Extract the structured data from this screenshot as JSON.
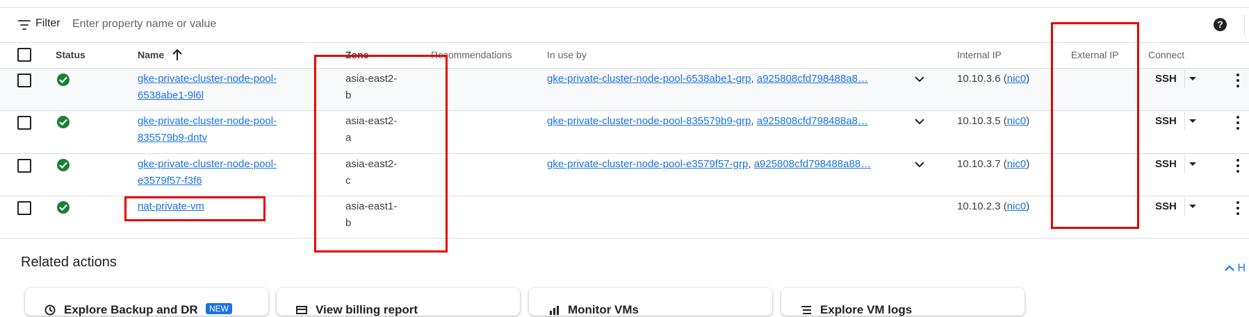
{
  "filter": {
    "label": "Filter",
    "placeholder": "Enter property name or value",
    "help_icon": "?"
  },
  "columns": {
    "status": "Status",
    "name": "Name",
    "zone": "Zone",
    "recommendations": "Recommendations",
    "in_use_by": "In use by",
    "internal_ip": "Internal IP",
    "external_ip": "External IP",
    "connect": "Connect"
  },
  "rows": [
    {
      "name_line1": "gke-private-cluster-node-pool-",
      "name_line2": "6538abe1-9l6l",
      "zone_line1": "asia-east2-",
      "zone_line2": "b",
      "in_use_link1": "gke-private-cluster-node-pool-6538abe1-grp",
      "in_use_sep": ", ",
      "in_use_link2": "a925808cfd798488a8…",
      "ip": "10.10.3.6",
      "ip_open": " (",
      "nic": "nic0",
      "ip_close": ")",
      "connect": "SSH",
      "status": "running"
    },
    {
      "name_line1": "gke-private-cluster-node-pool-",
      "name_line2": "835579b9-dntv",
      "zone_line1": "asia-east2-",
      "zone_line2": "a",
      "in_use_link1": "gke-private-cluster-node-pool-835579b9-grp",
      "in_use_sep": ", ",
      "in_use_link2": "a925808cfd798488a8…",
      "ip": "10.10.3.5",
      "ip_open": " (",
      "nic": "nic0",
      "ip_close": ")",
      "connect": "SSH",
      "status": "running"
    },
    {
      "name_line1": "gke-private-cluster-node-pool-",
      "name_line2": "e3579f57-f3f6",
      "zone_line1": "asia-east2-",
      "zone_line2": "c",
      "in_use_link1": "gke-private-cluster-node-pool-e3579f57-grp",
      "in_use_sep": ", ",
      "in_use_link2": "a925808cfd798488a88…",
      "ip": "10.10.3.7",
      "ip_open": " (",
      "nic": "nic0",
      "ip_close": ")",
      "connect": "SSH",
      "status": "running"
    },
    {
      "name_line1": "nat-private-vm",
      "zone_line1": "asia-east1-",
      "zone_line2": "b",
      "ip": "10.10.2.3",
      "ip_open": " (",
      "nic": "nic0",
      "ip_close": ")",
      "connect": "SSH",
      "status": "running"
    }
  ],
  "related": {
    "title": "Related actions",
    "hide_label": "H",
    "cards": [
      {
        "title": "Explore Backup and DR",
        "badge": "NEW",
        "icon": "backup-icon"
      },
      {
        "title": "View billing report",
        "icon": "billing-icon"
      },
      {
        "title": "Monitor VMs",
        "icon": "monitor-icon"
      },
      {
        "title": "Explore VM logs",
        "icon": "logs-icon"
      }
    ]
  },
  "colors": {
    "link": "#1a73e8",
    "status_ok": "#188038",
    "highlight": "#e60000"
  }
}
